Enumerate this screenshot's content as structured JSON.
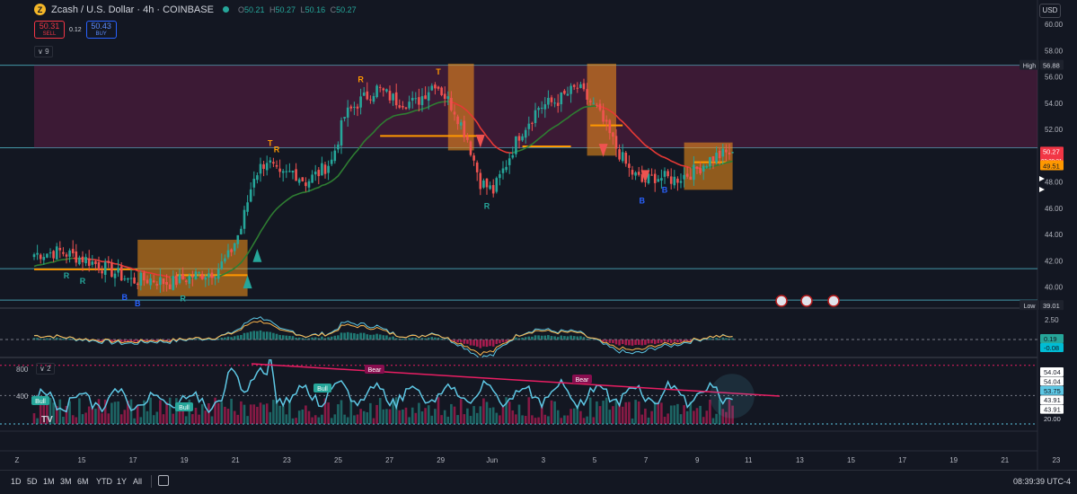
{
  "header": {
    "title": "Zcash / U.S. Dollar · 4h · COINBASE",
    "coin_glyph": "Z",
    "ohlc": [
      {
        "k": "O",
        "v": "50.21"
      },
      {
        "k": "H",
        "v": "50.27"
      },
      {
        "k": "L",
        "v": "50.16"
      },
      {
        "k": "C",
        "v": "50.27"
      }
    ],
    "sell_price": "50.31",
    "sell_label": "SELL",
    "spread": "0.12",
    "buy_price": "50.43",
    "buy_label": "BUY",
    "currency": "USD"
  },
  "pane_controls": {
    "main": "9",
    "osc": "2"
  },
  "colors": {
    "bull": "#26a69a",
    "bear": "#ef5350",
    "trail_bull": "#2e7d32",
    "trail_bear": "#e53935",
    "zone_fill": "#f7931a",
    "range_fill": "#6e1e4e",
    "osc_line": "#5ec8e5",
    "trend_line": "#e91e63"
  },
  "chart_data": {
    "type": "candlestick",
    "price_axis": {
      "ticks": [
        "60.00",
        "58.00",
        "56.00",
        "54.00",
        "52.00",
        "50.00",
        "48.00",
        "46.00",
        "44.00",
        "42.00",
        "40.00"
      ],
      "range": [
        39.0,
        60.5
      ]
    },
    "time_axis": {
      "labels": [
        "Z",
        "15",
        "17",
        "19",
        "21",
        "23",
        "25",
        "27",
        "29",
        "Jun",
        "3",
        "5",
        "7",
        "9",
        "11",
        "13",
        "15",
        "17",
        "19",
        "21",
        "23"
      ]
    },
    "levels": {
      "high": {
        "label": "High",
        "value": "56.88"
      },
      "low": {
        "label": "Low",
        "value": "39.01"
      },
      "last": {
        "value": "50.27",
        "countdown": "03:20:21"
      },
      "trail": {
        "value": "49.51"
      }
    },
    "key_levels": [
      56.88,
      50.6,
      41.4,
      39.01
    ],
    "close_anchors": [
      [
        0,
        42.5
      ],
      [
        8,
        42.7
      ],
      [
        16,
        42.1
      ],
      [
        24,
        41.2
      ],
      [
        30,
        40.5
      ],
      [
        36,
        40.6
      ],
      [
        42,
        40.3
      ],
      [
        50,
        40.9
      ],
      [
        56,
        41.2
      ],
      [
        60,
        42.3
      ],
      [
        64,
        44.5
      ],
      [
        68,
        48.5
      ],
      [
        72,
        49.7
      ],
      [
        76,
        48.3
      ],
      [
        80,
        48.8
      ],
      [
        84,
        48.0
      ],
      [
        88,
        48.7
      ],
      [
        92,
        49.6
      ],
      [
        96,
        53.0
      ],
      [
        100,
        54.0
      ],
      [
        106,
        55.1
      ],
      [
        112,
        54.2
      ],
      [
        118,
        54.0
      ],
      [
        124,
        55.6
      ],
      [
        130,
        53.5
      ],
      [
        134,
        51.3
      ],
      [
        138,
        48.0
      ],
      [
        142,
        47.3
      ],
      [
        146,
        49.4
      ],
      [
        150,
        51.6
      ],
      [
        156,
        53.7
      ],
      [
        162,
        54.2
      ],
      [
        168,
        55.2
      ],
      [
        174,
        53.5
      ],
      [
        180,
        50.6
      ],
      [
        184,
        48.9
      ],
      [
        188,
        48.0
      ],
      [
        192,
        48.4
      ],
      [
        198,
        48.2
      ],
      [
        204,
        48.8
      ],
      [
        210,
        49.9
      ],
      [
        216,
        50.27
      ]
    ],
    "markers": [
      {
        "text": "R",
        "i": 10,
        "pos": "below",
        "color": "#26a69a"
      },
      {
        "text": "R",
        "i": 15,
        "pos": "below",
        "color": "#26a69a"
      },
      {
        "text": "B",
        "i": 28,
        "pos": "below",
        "color": "#2962ff"
      },
      {
        "text": "B",
        "i": 32,
        "pos": "below",
        "color": "#2962ff"
      },
      {
        "text": "R",
        "i": 46,
        "pos": "below",
        "color": "#26a69a"
      },
      {
        "text": "T",
        "i": 73,
        "pos": "above",
        "color": "#ff9800"
      },
      {
        "text": "R",
        "i": 75,
        "pos": "above",
        "color": "#ff9800"
      },
      {
        "text": "R",
        "i": 101,
        "pos": "above",
        "color": "#ff9800"
      },
      {
        "text": "T",
        "i": 125,
        "pos": "above",
        "color": "#ff9800"
      },
      {
        "text": "R",
        "i": 140,
        "pos": "below",
        "color": "#26a69a"
      },
      {
        "text": "B",
        "i": 188,
        "pos": "below",
        "color": "#2962ff"
      },
      {
        "text": "B",
        "i": 195,
        "pos": "below",
        "color": "#2962ff"
      }
    ],
    "macd": {
      "tick": "2.50",
      "labels": [
        {
          "text": "0.19",
          "bg": "#26a69a"
        },
        {
          "text": "-0.08",
          "bg": "#00bcd4"
        }
      ]
    },
    "oscillator": {
      "ticks": [
        "800",
        "400"
      ],
      "right_labels": [
        {
          "text": "54.04",
          "bg": "#ffffff",
          "fg": "#131722"
        },
        {
          "text": "54.04",
          "bg": "#ffffff",
          "fg": "#131722"
        },
        {
          "text": "53.75",
          "bg": "#5ec8e5",
          "fg": "#131722"
        },
        {
          "text": "43.91",
          "bg": "#ffffff",
          "fg": "#131722"
        },
        {
          "text": "43.91",
          "bg": "#ffffff",
          "fg": "#131722"
        },
        {
          "text": "20.00",
          "bg": "none",
          "fg": "#d1d4dc"
        }
      ],
      "bull_labels": [
        "Bull",
        "Bull",
        "Bull"
      ],
      "bear_labels": [
        "Bear",
        "Bear"
      ]
    }
  },
  "bottom": {
    "timeframes": [
      "1D",
      "5D",
      "1M",
      "3M",
      "6M",
      "YTD",
      "1Y",
      "All"
    ],
    "clock": "08:39:39 UTC-4"
  }
}
